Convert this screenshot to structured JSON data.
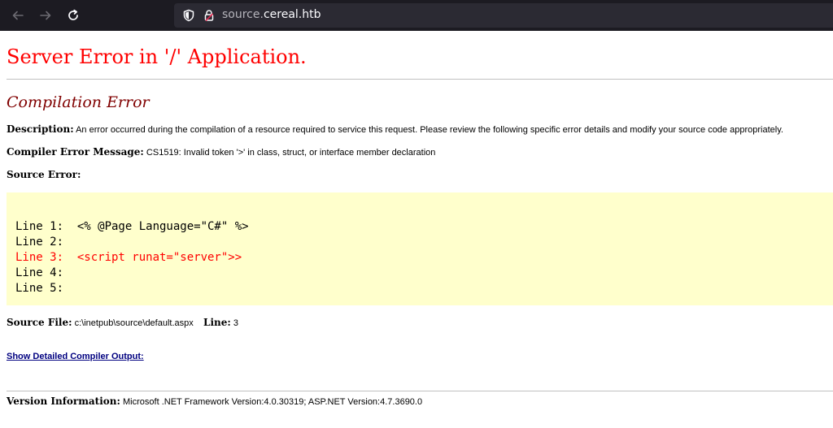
{
  "browser": {
    "url_prefix": "source.",
    "url_domain": "cereal.htb"
  },
  "error": {
    "title": "Server Error in '/' Application.",
    "subtitle": "Compilation Error",
    "description_label": "Description:",
    "description_text": "An error occurred during the compilation of a resource required to service this request. Please review the following specific error details and modify your source code appropriately.",
    "message_label": "Compiler Error Message:",
    "message_text": "CS1519: Invalid token '>' in class, struct, or interface member declaration",
    "source_error_label": "Source Error:",
    "source_lines": [
      "Line 1:  <% @Page Language=\"C#\" %>",
      "Line 2:",
      "Line 3:  <script runat=\"server\">>",
      "Line 4:",
      "Line 5:"
    ],
    "error_line_color": "#ff0000",
    "source_file_label": "Source File:",
    "source_file_value": "c:\\inetpub\\source\\default.aspx",
    "line_label": "Line:",
    "line_value": "3",
    "details_link": "Show Detailed Compiler Output:",
    "version_label": "Version Information:",
    "version_text": "Microsoft .NET Framework Version:4.0.30319; ASP.NET Version:4.7.3690.0"
  },
  "colors": {
    "title": "#ff0000",
    "subtitle": "#800000",
    "code_background": "#ffffcc",
    "link": "#000080",
    "toolbar": "#1c1b22",
    "urlbar": "#2b2a33"
  },
  "icons": [
    "back-arrow-icon",
    "forward-arrow-icon",
    "reload-icon",
    "shield-icon",
    "lock-icon"
  ]
}
